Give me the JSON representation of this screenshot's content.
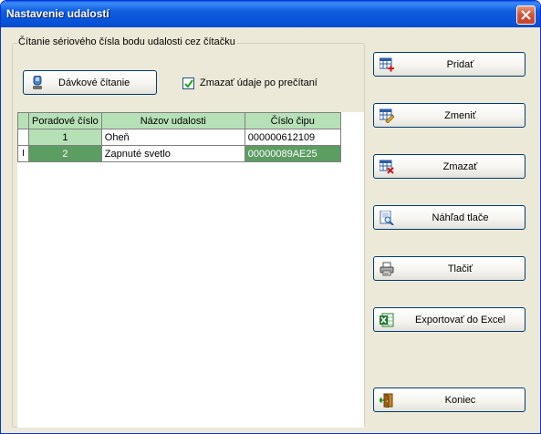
{
  "window": {
    "title": "Nastavenie udalostí"
  },
  "group": {
    "label": "Čítanie sériového čísla bodu udalosti cez čítačku",
    "batch_button": "Dávkové čítanie",
    "checkbox_label": "Zmazať údaje po prečítaní",
    "checkbox_checked": true
  },
  "grid": {
    "columns": [
      "Poradové číslo",
      "Názov udalosti",
      "Číslo čipu"
    ],
    "rows": [
      {
        "marker": "",
        "order": "1",
        "name": "Oheň",
        "chip": "000000612109"
      },
      {
        "marker": "I",
        "order": "2",
        "name": "Zapnuté svetlo",
        "chip": "00000089AE25"
      }
    ]
  },
  "buttons": {
    "add": "Pridať",
    "edit": "Zmeniť",
    "delete": "Zmazať",
    "preview": "Náhľad tlače",
    "print": "Tlačiť",
    "export": "Exportovať do Excel",
    "exit": "Koniec"
  },
  "icons": {
    "add": "table-add-icon",
    "edit": "table-edit-icon",
    "delete": "table-delete-icon",
    "preview": "print-preview-icon",
    "print": "printer-icon",
    "export": "excel-icon",
    "exit": "exit-door-icon",
    "batch": "reader-icon"
  },
  "colors": {
    "title_bar": "#0a5fe6",
    "grid_header": "#b6e0b6",
    "selected_row": "#5c9d62"
  }
}
